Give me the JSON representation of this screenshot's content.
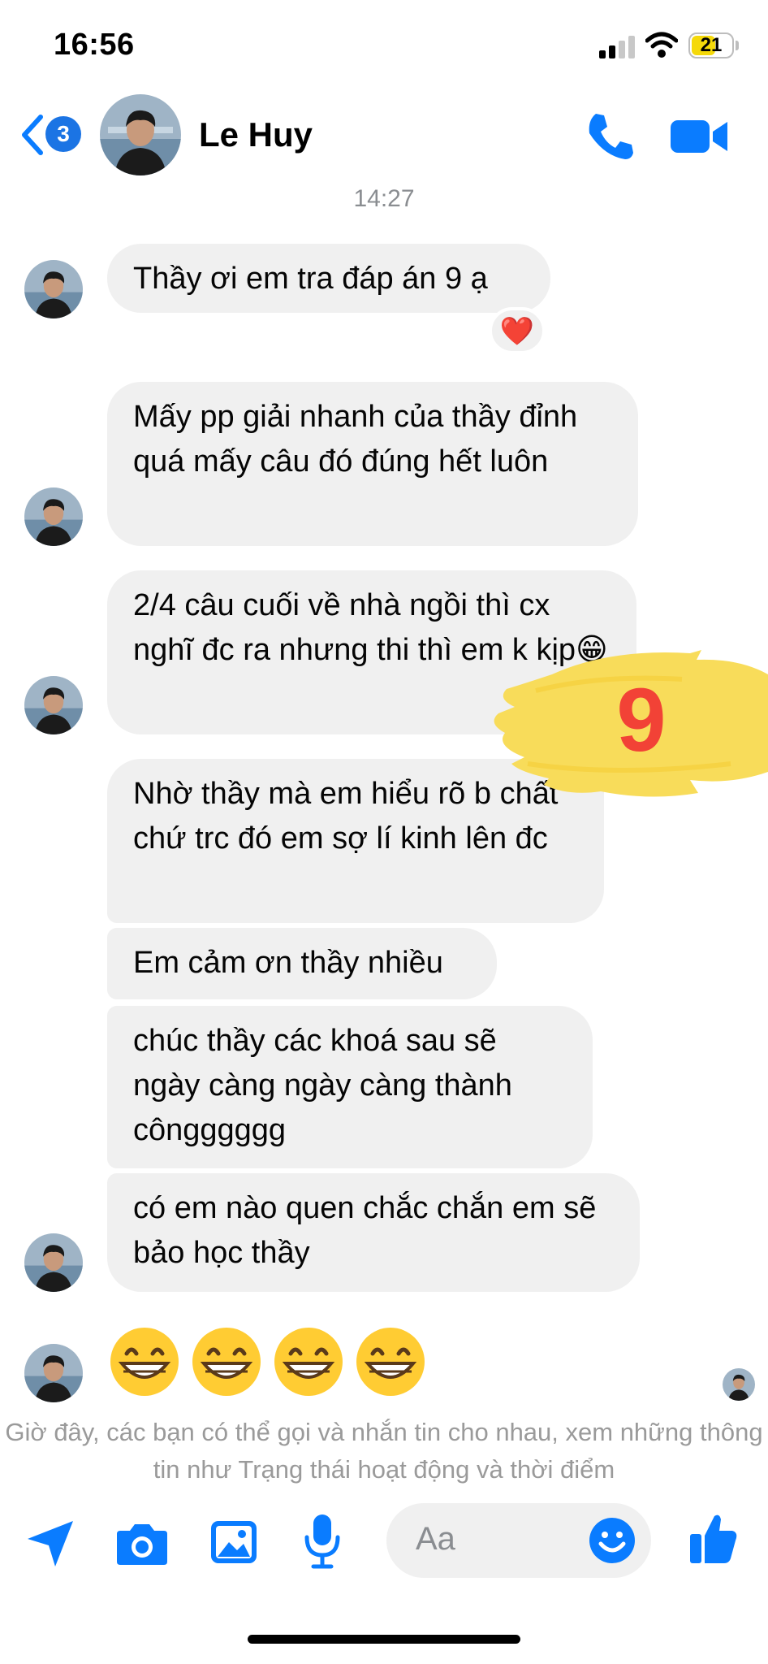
{
  "status_bar": {
    "time": "16:56",
    "battery": "21"
  },
  "header": {
    "unread_count": "3",
    "contact_name": "Le Huy",
    "icons": [
      "back-chevron-icon",
      "phone-icon",
      "video-camera-icon"
    ]
  },
  "conversation": {
    "timestamp": "14:27",
    "messages": [
      {
        "text": "Thầy ơi em tra đáp án 9 ạ",
        "reaction": "❤️"
      },
      {
        "text": "Mấy pp giải nhanh của thầy đỉnh quá mấy câu đó đúng hết luôn"
      },
      {
        "text": "2/4 câu cuối về nhà ngồi thì cx nghĩ đc ra nhưng thi thì em k kịp😁"
      },
      {
        "text": "Nhờ thầy mà em hiểu rõ b chất chứ trc đó em sợ lí kinh lên đc"
      },
      {
        "text": "Em cảm ơn thầy nhiều"
      },
      {
        "text": "chúc thầy các khoá sau sẽ ngày càng ngày càng thành côngggggg"
      },
      {
        "text": "có em nào quen chắc chắn em sẽ bảo học thầy"
      }
    ],
    "emoji_message": "😁😁😁😁",
    "notice": "Giờ đây, các bạn có thể gọi và nhắn tin cho nhau, xem những thông tin như Trạng thái hoạt động và thời điểm"
  },
  "overlay": {
    "score": "9",
    "brush_color": "#f8dc5a",
    "text_color": "#f24236"
  },
  "composer": {
    "placeholder": "Aa",
    "accent": "#0a7cff",
    "icons": [
      "send-arrow-icon",
      "camera-icon",
      "photo-icon",
      "microphone-icon",
      "emoji-icon",
      "like-thumb-icon"
    ]
  }
}
